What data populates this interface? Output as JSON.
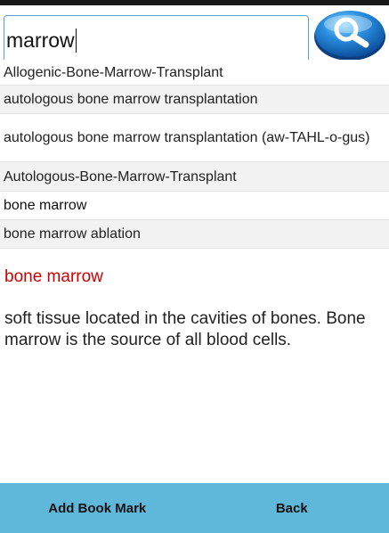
{
  "search": {
    "value": "marrow",
    "button_icon": "search-icon"
  },
  "suggestions": [
    "Allogenic-Bone-Marrow-Transplant",
    "autologous bone marrow transplantation",
    "autologous bone marrow transplantation (aw-TAHL-o-gus)",
    "Autologous-Bone-Marrow-Transplant",
    "bone marrow",
    "bone marrow ablation"
  ],
  "definition": {
    "term": "bone marrow",
    "text": "soft tissue located in the cavities of bones. Bone marrow is the source of all blood cells."
  },
  "bottom_bar": {
    "bookmark_label": "Add Book Mark",
    "back_label": "Back"
  },
  "colors": {
    "accent": "#5fb8da",
    "term": "#cc0000",
    "input_border": "#5aa0c8"
  }
}
